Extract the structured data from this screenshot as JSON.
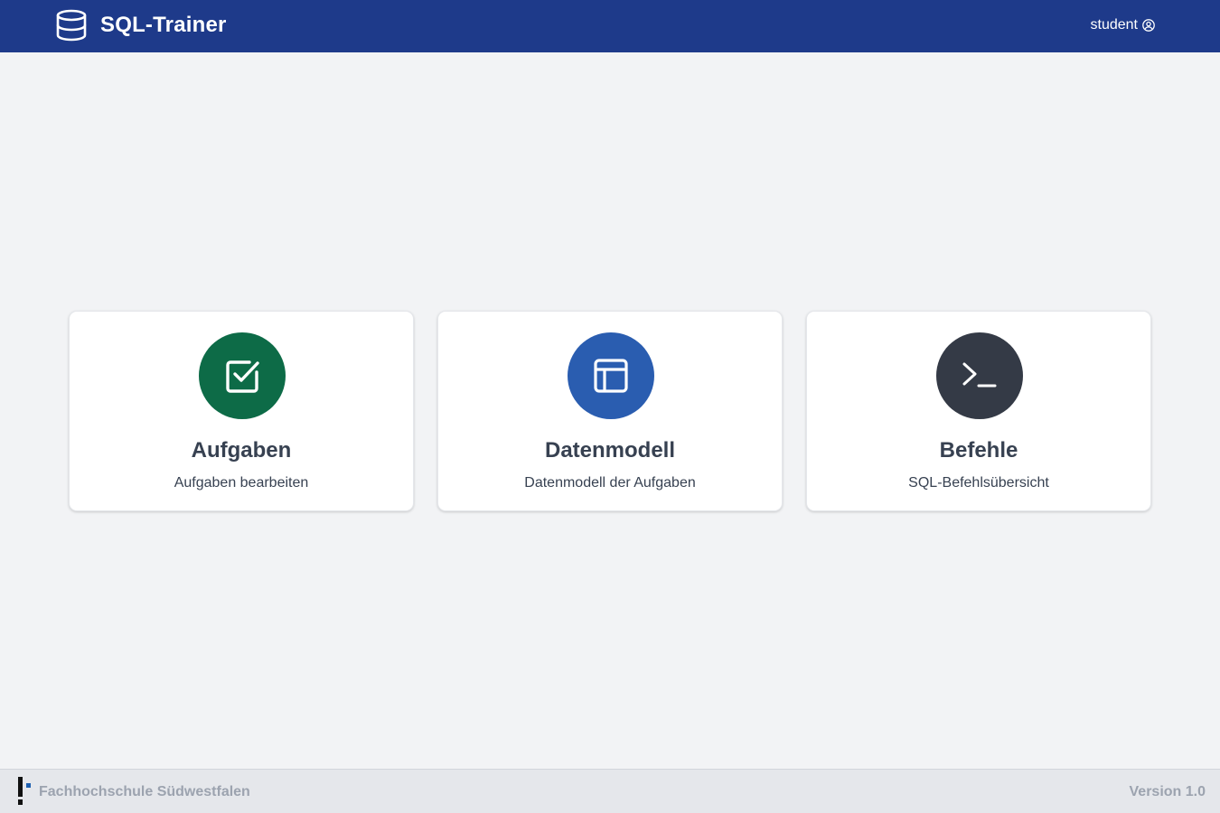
{
  "header": {
    "app_title": "SQL-Trainer",
    "user_label": "student",
    "brand_icon": "database-icon",
    "user_icon": "user-circle-icon",
    "background_color": "#1e3a8a"
  },
  "cards": [
    {
      "title": "Aufgaben",
      "description": "Aufgaben bearbeiten",
      "icon": "checkbox-icon",
      "color": "#0d6b47"
    },
    {
      "title": "Datenmodell",
      "description": "Datenmodell der Aufgaben",
      "icon": "table-layout-icon",
      "color": "#2a5db0"
    },
    {
      "title": "Befehle",
      "description": "SQL-Befehlsübersicht",
      "icon": "terminal-icon",
      "color": "#343a46"
    }
  ],
  "footer": {
    "organization": "Fachhochschule Südwestfalen",
    "version": "Version 1.0",
    "logo_icon": "fh-logo-icon"
  }
}
